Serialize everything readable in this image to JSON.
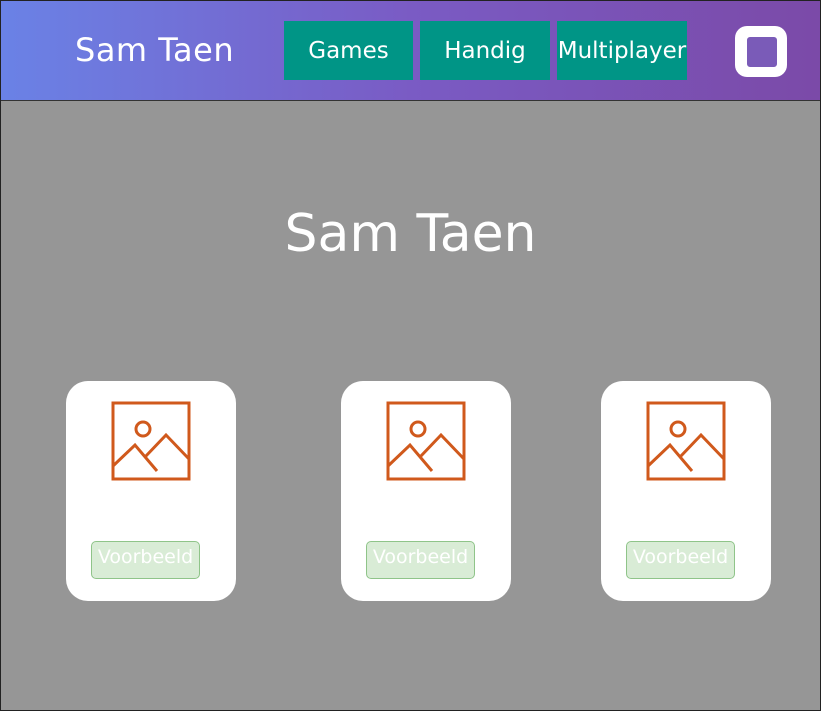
{
  "header": {
    "brand": "Sam Taen",
    "nav": [
      "Games",
      "Handig",
      "Multiplayer"
    ],
    "menu_icon": "square-icon"
  },
  "hero": {
    "title": "Sam Taen"
  },
  "cards": [
    {
      "icon": "image-placeholder-icon",
      "button_label": "Voorbeeld"
    },
    {
      "icon": "image-placeholder-icon",
      "button_label": "Voorbeeld"
    },
    {
      "icon": "image-placeholder-icon",
      "button_label": "Voorbeeld"
    }
  ],
  "colors": {
    "nav_button": "#009586",
    "icon_stroke": "#d0591c",
    "card_button_bg": "#d9ecd6",
    "page_bg": "#969696"
  }
}
